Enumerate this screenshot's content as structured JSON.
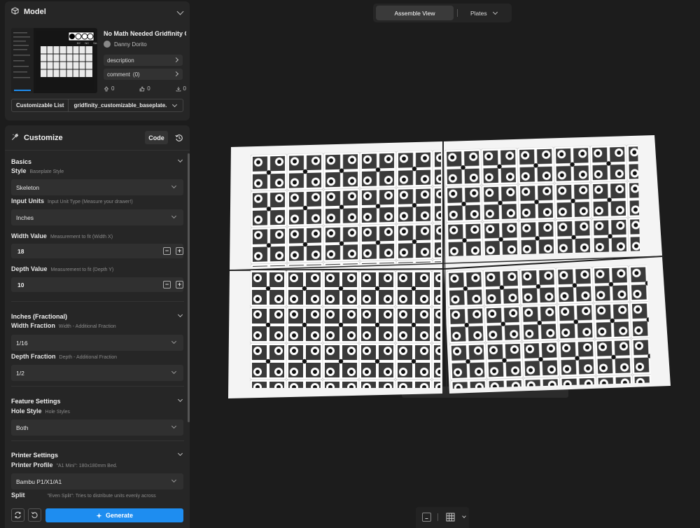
{
  "model_panel": {
    "title": "Model",
    "model_name": "No Math Needed Gridfinity Customizable Baseplate",
    "author": "Danny Dorito",
    "license_badges": [
      "BY",
      "NC",
      "SA"
    ],
    "description_label": "description",
    "comment_label": "comment",
    "comment_count": "(0)",
    "stats": {
      "boosts": "0",
      "likes": "0",
      "downloads": "0"
    },
    "customizable_list_label": "Customizable List",
    "customizable_list_value": "gridfinity_customizable_baseplate.scad"
  },
  "customize_panel": {
    "title": "Customize",
    "code_label": "Code",
    "sections": {
      "basics": "Basics",
      "inches_fractional": "Inches (Fractional)",
      "feature_settings": "Feature Settings",
      "printer_settings": "Printer Settings"
    },
    "fields": {
      "style": {
        "label": "Style",
        "hint": "Baseplate Style",
        "value": "Skeleton"
      },
      "input_units": {
        "label": "Input Units",
        "hint": "Input Unit Type (Measure your drawer!)",
        "value": "Inches"
      },
      "width_value": {
        "label": "Width Value",
        "hint": "Measurement to fit (Width X)",
        "value": "18"
      },
      "depth_value": {
        "label": "Depth Value",
        "hint": "Measurement to fit (Depth Y)",
        "value": "10"
      },
      "width_fraction": {
        "label": "Width Fraction",
        "hint": "Width - Additional Fraction",
        "value": "1/16"
      },
      "depth_fraction": {
        "label": "Depth Fraction",
        "hint": "Depth - Additional Fraction",
        "value": "1/2"
      },
      "hole_style": {
        "label": "Hole Style",
        "hint": "Hole Styles",
        "value": "Both"
      },
      "printer_profile": {
        "label": "Printer Profile",
        "hint": "\"A1 Mini\": 180x180mm Bed.",
        "value": "Bambu P1/X1/A1"
      },
      "split": {
        "label": "Split",
        "hint": "\"Even Split\": Tries to distribute units evenly across"
      }
    },
    "generate_label": "Generate"
  },
  "top_bar": {
    "assemble_view_label": "Assemble View",
    "plates_label": "Plates"
  },
  "colors": {
    "accent": "#1e8df0",
    "background": "#1c1c1c",
    "panel": "#262626"
  }
}
